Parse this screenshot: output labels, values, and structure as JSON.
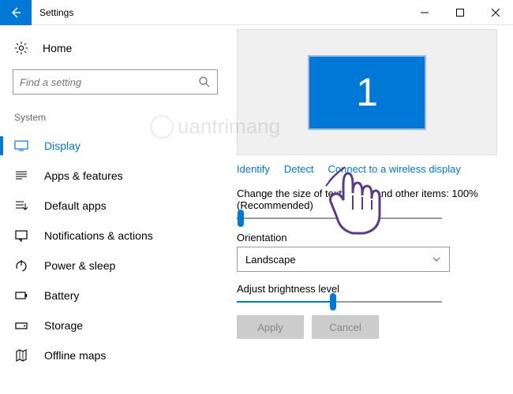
{
  "window": {
    "title": "Settings"
  },
  "sidebar": {
    "home": "Home",
    "searchPlaceholder": "Find a setting",
    "category": "System",
    "items": [
      {
        "label": "Display"
      },
      {
        "label": "Apps & features"
      },
      {
        "label": "Default apps"
      },
      {
        "label": "Notifications & actions"
      },
      {
        "label": "Power & sleep"
      },
      {
        "label": "Battery"
      },
      {
        "label": "Storage"
      },
      {
        "label": "Offline maps"
      }
    ]
  },
  "main": {
    "monitorNumber": "1",
    "links": {
      "identify": "Identify",
      "detect": "Detect",
      "connect": "Connect to a wireless display"
    },
    "scaleLabel": "Change the size of text, apps, and other items: 100% (Recommended)",
    "orientationLabel": "Orientation",
    "orientationValue": "Landscape",
    "brightnessLabel": "Adjust brightness level",
    "applyLabel": "Apply",
    "cancelLabel": "Cancel"
  },
  "watermark": "uantrimang"
}
